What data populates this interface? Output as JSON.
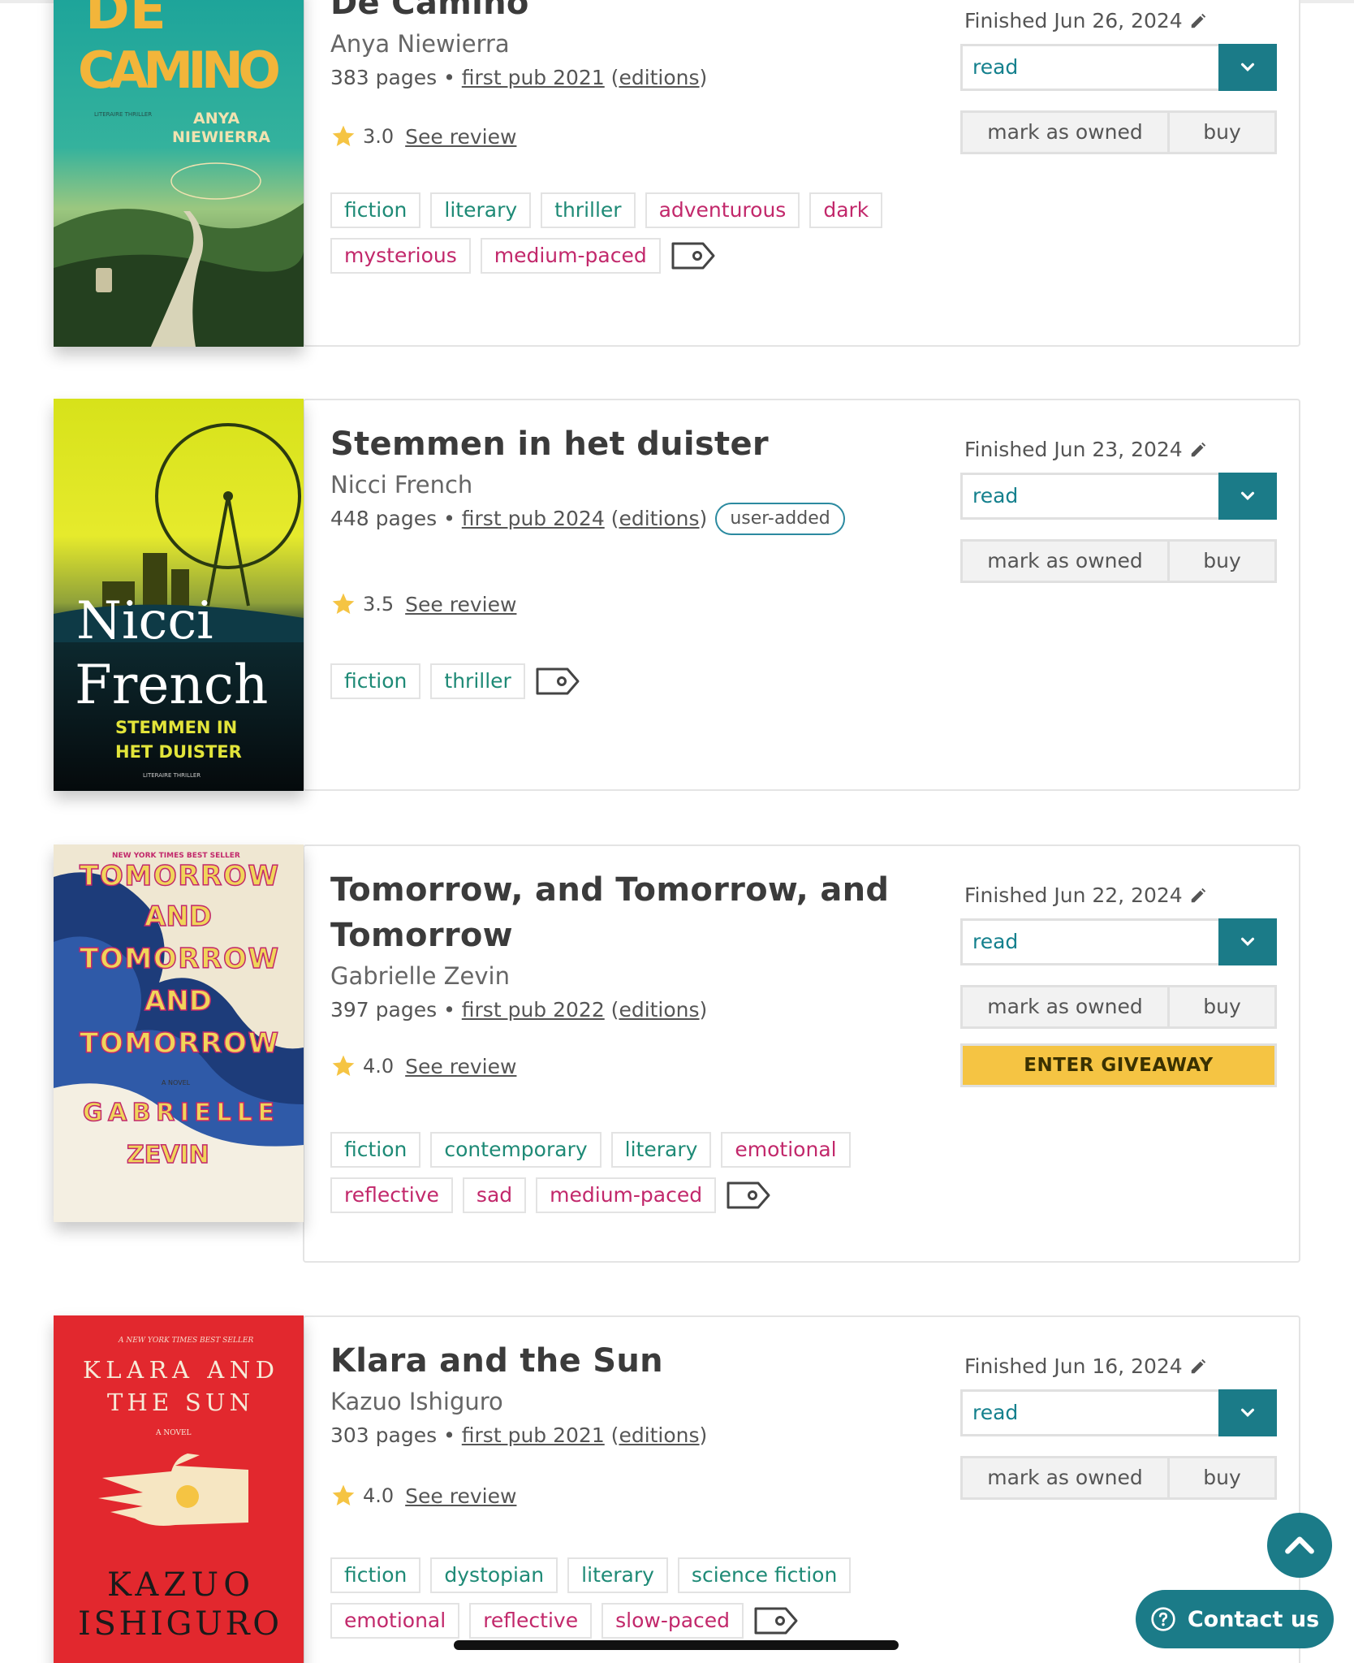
{
  "colors": {
    "teal": "#1b7b88",
    "tag_green": "#1e8a76",
    "tag_magenta": "#c2286b",
    "giveaway": "#f5c443"
  },
  "books": [
    {
      "title": "De Camino",
      "author": "Anya Niewierra",
      "pages": "383 pages",
      "first_pub": "first pub 2021",
      "editions": "editions",
      "rating": "3.0",
      "see_review": "See review",
      "finished": "Finished Jun 26, 2024",
      "status": "read",
      "mark_owned": "mark as owned",
      "buy": "buy",
      "tags": [
        "fiction",
        "literary",
        "thriller",
        "adventurous",
        "dark",
        "mysterious",
        "medium-paced"
      ],
      "cover": {
        "line1": "DE",
        "line2": "CAMINO",
        "author1": "ANYA",
        "author2": "NIEWIERRA",
        "genre": "LITERAIRE THRILLER"
      }
    },
    {
      "title": "Stemmen in het duister",
      "author": "Nicci French",
      "pages": "448 pages",
      "first_pub": "first pub 2024",
      "editions": "editions",
      "badge": "user-added",
      "rating": "3.5",
      "see_review": "See review",
      "finished": "Finished Jun 23, 2024",
      "status": "read",
      "mark_owned": "mark as owned",
      "buy": "buy",
      "tags": [
        "fiction",
        "thriller"
      ],
      "cover": {
        "name1": "Nicci",
        "name2": "French",
        "title1": "STEMMEN IN",
        "title2": "HET DUISTER",
        "genre": "LITERAIRE THRILLER"
      }
    },
    {
      "title": "Tomorrow, and Tomorrow, and Tomorrow",
      "title_l1": "Tomorrow, and Tomorrow, and",
      "title_l2": "Tomorrow",
      "author": "Gabrielle Zevin",
      "pages": "397 pages",
      "first_pub": "first pub 2022",
      "editions": "editions",
      "rating": "4.0",
      "see_review": "See review",
      "finished": "Finished Jun 22, 2024",
      "status": "read",
      "mark_owned": "mark as owned",
      "buy": "buy",
      "giveaway": "ENTER GIVEAWAY",
      "tags": [
        "fiction",
        "contemporary",
        "literary",
        "emotional",
        "reflective",
        "sad",
        "medium-paced"
      ],
      "cover": {
        "top": "NEW YORK TIMES BEST SELLER",
        "w1": "TOMORROW",
        "w2": "AND",
        "w3": "TOMORROW",
        "w4": "AND",
        "w5": "TOMORROW",
        "novel": "A NOVEL",
        "a1": "GABRIELLE",
        "a2": "ZEVIN"
      }
    },
    {
      "title": "Klara and the Sun",
      "author": "Kazuo Ishiguro",
      "pages": "303 pages",
      "first_pub": "first pub 2021",
      "editions": "editions",
      "rating": "4.0",
      "see_review": "See review",
      "finished": "Finished Jun 16, 2024",
      "status": "read",
      "mark_owned": "mark as owned",
      "buy": "buy",
      "tags": [
        "fiction",
        "dystopian",
        "literary",
        "science fiction",
        "emotional",
        "reflective",
        "slow-paced"
      ],
      "cover": {
        "top": "A NEW YORK TIMES BEST SELLER",
        "t1": "KLARA AND",
        "t2": "THE SUN",
        "novel": "A NOVEL",
        "a1": "KAZUO",
        "a2": "ISHIGURO"
      }
    }
  ],
  "contact_us": "Contact us"
}
